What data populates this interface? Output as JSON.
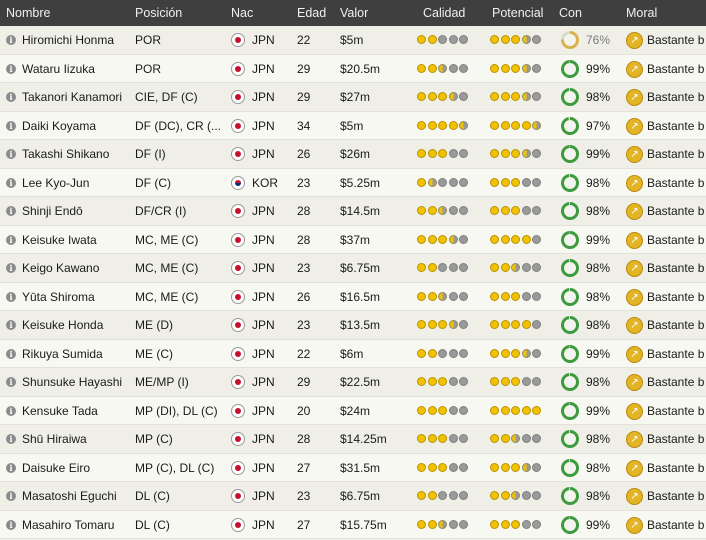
{
  "headers": {
    "name": "Nombre",
    "position": "Posición",
    "nation": "Nac",
    "age": "Edad",
    "value": "Valor",
    "quality": "Calidad",
    "potential": "Potencial",
    "condition": "Con",
    "morale": "Moral"
  },
  "colors": {
    "star_full": "#f2c200",
    "star_empty": "#9a9a9a",
    "condition_good": "#3e9a3e",
    "condition_low": "#d8b24a",
    "morale_icon": "#e3b424"
  },
  "info_glyph": "i",
  "morale_glyph": "↗",
  "players": [
    {
      "name": "Hiromichi Honma",
      "position": "POR",
      "nation": "JPN",
      "flag": "jpn",
      "age": "22",
      "value": "$5m",
      "quality": 2.0,
      "potential": 3.5,
      "condition_text": "76%",
      "condition": 76,
      "morale": "Bastante bien"
    },
    {
      "name": "Wataru Iizuka",
      "position": "POR",
      "nation": "JPN",
      "flag": "jpn",
      "age": "29",
      "value": "$20.5m",
      "quality": 2.5,
      "potential": 3.5,
      "condition_text": "99%",
      "condition": 99,
      "morale": "Bastante bien"
    },
    {
      "name": "Takanori Kanamori",
      "position": "CIE, DF (C)",
      "nation": "JPN",
      "flag": "jpn",
      "age": "29",
      "value": "$27m",
      "quality": 3.5,
      "potential": 3.5,
      "condition_text": "98%",
      "condition": 98,
      "morale": "Bastante bien"
    },
    {
      "name": "Daiki Koyama",
      "position": "DF (DC), CR (...",
      "nation": "JPN",
      "flag": "jpn",
      "age": "34",
      "value": "$5m",
      "quality": 4.5,
      "potential": 4.5,
      "condition_text": "97%",
      "condition": 97,
      "morale": "Bastante bien"
    },
    {
      "name": "Takashi Shikano",
      "position": "DF (I)",
      "nation": "JPN",
      "flag": "jpn",
      "age": "26",
      "value": "$26m",
      "quality": 3.0,
      "potential": 3.5,
      "condition_text": "99%",
      "condition": 99,
      "morale": "Bastante bien"
    },
    {
      "name": "Lee Kyo-Jun",
      "position": "DF (C)",
      "nation": "KOR",
      "flag": "kor",
      "age": "23",
      "value": "$5.25m",
      "quality": 1.5,
      "potential": 3.0,
      "condition_text": "98%",
      "condition": 98,
      "morale": "Bastante bien"
    },
    {
      "name": "Shinji Endō",
      "position": "DF/CR (I)",
      "nation": "JPN",
      "flag": "jpn",
      "age": "28",
      "value": "$14.5m",
      "quality": 2.5,
      "potential": 3.0,
      "condition_text": "98%",
      "condition": 98,
      "morale": "Bastante bien"
    },
    {
      "name": "Keisuke Iwata",
      "position": "MC, ME (C)",
      "nation": "JPN",
      "flag": "jpn",
      "age": "28",
      "value": "$37m",
      "quality": 3.5,
      "potential": 4.0,
      "condition_text": "99%",
      "condition": 99,
      "morale": "Bastante bien"
    },
    {
      "name": "Keigo Kawano",
      "position": "MC, ME (C)",
      "nation": "JPN",
      "flag": "jpn",
      "age": "23",
      "value": "$6.75m",
      "quality": 2.0,
      "potential": 2.5,
      "condition_text": "98%",
      "condition": 98,
      "morale": "Bastante bien"
    },
    {
      "name": "Yūta Shiroma",
      "position": "MC, ME (C)",
      "nation": "JPN",
      "flag": "jpn",
      "age": "26",
      "value": "$16.5m",
      "quality": 2.5,
      "potential": 3.0,
      "condition_text": "98%",
      "condition": 98,
      "morale": "Bastante bien"
    },
    {
      "name": "Keisuke Honda",
      "position": "ME (D)",
      "nation": "JPN",
      "flag": "jpn",
      "age": "23",
      "value": "$13.5m",
      "quality": 3.5,
      "potential": 4.0,
      "condition_text": "98%",
      "condition": 98,
      "morale": "Bastante bien"
    },
    {
      "name": "Rikuya Sumida",
      "position": "ME (C)",
      "nation": "JPN",
      "flag": "jpn",
      "age": "22",
      "value": "$6m",
      "quality": 2.0,
      "potential": 3.5,
      "condition_text": "99%",
      "condition": 99,
      "morale": "Bastante bien"
    },
    {
      "name": "Shunsuke Hayashi",
      "position": "ME/MP (I)",
      "nation": "JPN",
      "flag": "jpn",
      "age": "29",
      "value": "$22.5m",
      "quality": 3.0,
      "potential": 3.0,
      "condition_text": "98%",
      "condition": 98,
      "morale": "Bastante bien"
    },
    {
      "name": "Kensuke Tada",
      "position": "MP (DI), DL (C)",
      "nation": "JPN",
      "flag": "jpn",
      "age": "20",
      "value": "$24m",
      "quality": 3.0,
      "potential": 5.0,
      "condition_text": "99%",
      "condition": 99,
      "morale": "Bastante bien"
    },
    {
      "name": "Shū Hiraiwa",
      "position": "MP (C)",
      "nation": "JPN",
      "flag": "jpn",
      "age": "28",
      "value": "$14.25m",
      "quality": 3.0,
      "potential": 2.5,
      "condition_text": "98%",
      "condition": 98,
      "morale": "Bastante bien"
    },
    {
      "name": "Daisuke Eiro",
      "position": "MP (C), DL (C)",
      "nation": "JPN",
      "flag": "jpn",
      "age": "27",
      "value": "$31.5m",
      "quality": 3.0,
      "potential": 3.5,
      "condition_text": "98%",
      "condition": 98,
      "morale": "Bastante bien"
    },
    {
      "name": "Masatoshi Eguchi",
      "position": "DL (C)",
      "nation": "JPN",
      "flag": "jpn",
      "age": "23",
      "value": "$6.75m",
      "quality": 2.0,
      "potential": 2.5,
      "condition_text": "98%",
      "condition": 98,
      "morale": "Bastante bien"
    },
    {
      "name": "Masahiro Tomaru",
      "position": "DL (C)",
      "nation": "JPN",
      "flag": "jpn",
      "age": "27",
      "value": "$15.75m",
      "quality": 2.5,
      "potential": 3.0,
      "condition_text": "99%",
      "condition": 99,
      "morale": "Bastante bien"
    }
  ]
}
